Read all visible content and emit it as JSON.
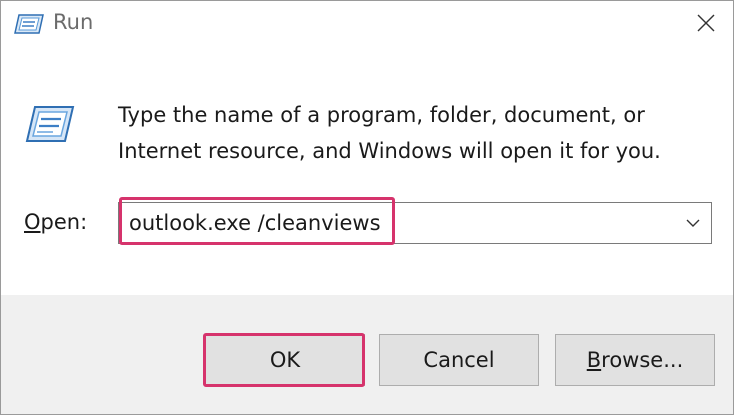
{
  "window": {
    "title": "Run",
    "title_icon": "run-dialog-icon",
    "close_icon": "close-icon"
  },
  "body": {
    "icon": "run-dialog-icon",
    "description": "Type the name of a program, folder, document, or Internet resource, and Windows will open it for you.",
    "open_label_prefix": "",
    "open_label_mnemonic": "O",
    "open_label_rest": "pen:",
    "open_value": "outlook.exe /cleanviews",
    "dropdown_icon": "chevron-down-icon"
  },
  "buttons": {
    "ok": "OK",
    "cancel": "Cancel",
    "browse_mnemonic": "B",
    "browse_rest": "rowse..."
  },
  "colors": {
    "highlight": "#d6336c",
    "footer_bg": "#f0f0f0",
    "button_bg": "#e1e1e1"
  }
}
